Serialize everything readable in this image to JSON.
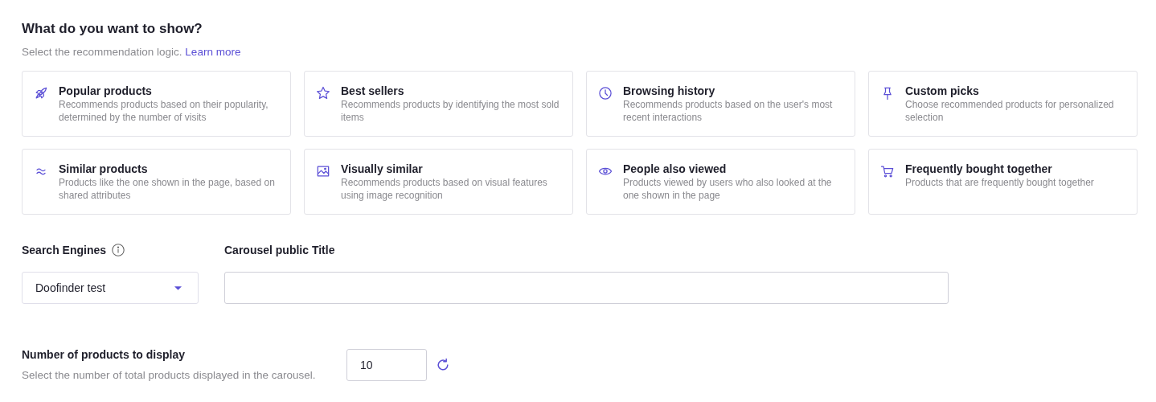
{
  "heading": "What do you want to show?",
  "subtitle": {
    "text": "Select the recommendation logic.",
    "link": "Learn more"
  },
  "options": [
    {
      "title": "Popular products",
      "description": "Recommends products based on their popularity, determined by the number of visits",
      "selected": false
    },
    {
      "title": "Best sellers",
      "description": "Recommends products by identifying the most sold items",
      "selected": false
    },
    {
      "title": "Browsing history",
      "description": "Recommends products based on the user's most recent interactions",
      "selected": false
    },
    {
      "title": "Custom picks",
      "description": "Choose recommended products for personalized selection",
      "selected": false
    },
    {
      "title": "Similar products",
      "description": "Products like the one shown in the page, based on shared attributes",
      "selected": false
    },
    {
      "title": "Visually similar",
      "description": "Recommends products based on visual features using image recognition",
      "selected": false
    },
    {
      "title": "People also viewed",
      "description": "Products viewed by users who also looked at the one shown in the page",
      "selected": false
    },
    {
      "title": "Frequently bought together",
      "description": "Products that are frequently bought together",
      "selected": false
    }
  ],
  "search_engines": {
    "label": "Search Engines",
    "value": "Doofinder test"
  },
  "carousel_title": {
    "label": "Carousel public Title"
  },
  "products_count": {
    "label": "Number of products to display",
    "hint": "Select the number of total products displayed in the carousel.",
    "value": "10"
  }
}
